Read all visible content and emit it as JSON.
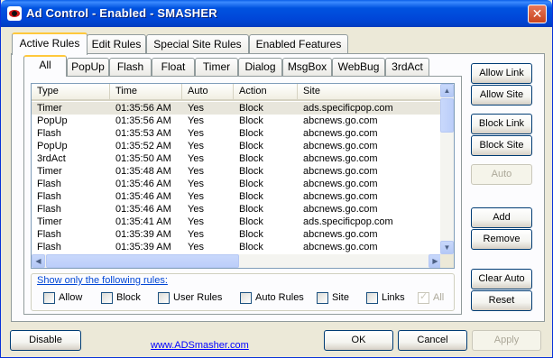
{
  "window": {
    "title": "Ad Control - Enabled - SMASHER",
    "close_glyph": "✕"
  },
  "outer_tabs": [
    "Active Rules",
    "Edit Rules",
    "Special Site Rules",
    "Enabled Features"
  ],
  "inner_tabs": [
    "All",
    "PopUp",
    "Flash",
    "Float",
    "Timer",
    "Dialog",
    "MsgBox",
    "WebBug",
    "3rdAct"
  ],
  "list": {
    "columns": [
      "Type",
      "Time",
      "Auto",
      "Action",
      "Site"
    ],
    "rows": [
      [
        "Timer",
        "01:35:56 AM",
        "Yes",
        "Block",
        "ads.specificpop.com"
      ],
      [
        "PopUp",
        "01:35:56 AM",
        "Yes",
        "Block",
        "abcnews.go.com"
      ],
      [
        "Flash",
        "01:35:53 AM",
        "Yes",
        "Block",
        "abcnews.go.com"
      ],
      [
        "PopUp",
        "01:35:52 AM",
        "Yes",
        "Block",
        "abcnews.go.com"
      ],
      [
        "3rdAct",
        "01:35:50 AM",
        "Yes",
        "Block",
        "abcnews.go.com"
      ],
      [
        "Timer",
        "01:35:48 AM",
        "Yes",
        "Block",
        "abcnews.go.com"
      ],
      [
        "Flash",
        "01:35:46 AM",
        "Yes",
        "Block",
        "abcnews.go.com"
      ],
      [
        "Flash",
        "01:35:46 AM",
        "Yes",
        "Block",
        "abcnews.go.com"
      ],
      [
        "Flash",
        "01:35:46 AM",
        "Yes",
        "Block",
        "abcnews.go.com"
      ],
      [
        "Timer",
        "01:35:41 AM",
        "Yes",
        "Block",
        "ads.specificpop.com"
      ],
      [
        "Flash",
        "01:35:39 AM",
        "Yes",
        "Block",
        "abcnews.go.com"
      ],
      [
        "Flash",
        "01:35:39 AM",
        "Yes",
        "Block",
        "abcnews.go.com"
      ]
    ]
  },
  "filter": {
    "title": "Show only the following rules:",
    "options": [
      "Allow",
      "Block",
      "User Rules",
      "Auto Rules",
      "Site",
      "Links",
      "All"
    ]
  },
  "side_buttons": {
    "allow_link": "Allow Link",
    "allow_site": "Allow Site",
    "block_link": "Block Link",
    "block_site": "Block Site",
    "auto": "Auto",
    "add": "Add",
    "remove": "Remove",
    "clear_auto": "Clear Auto",
    "reset": "Reset"
  },
  "bottom": {
    "disable": "Disable",
    "link": "www.ADSmasher.com",
    "ok": "OK",
    "cancel": "Cancel",
    "apply": "Apply"
  }
}
